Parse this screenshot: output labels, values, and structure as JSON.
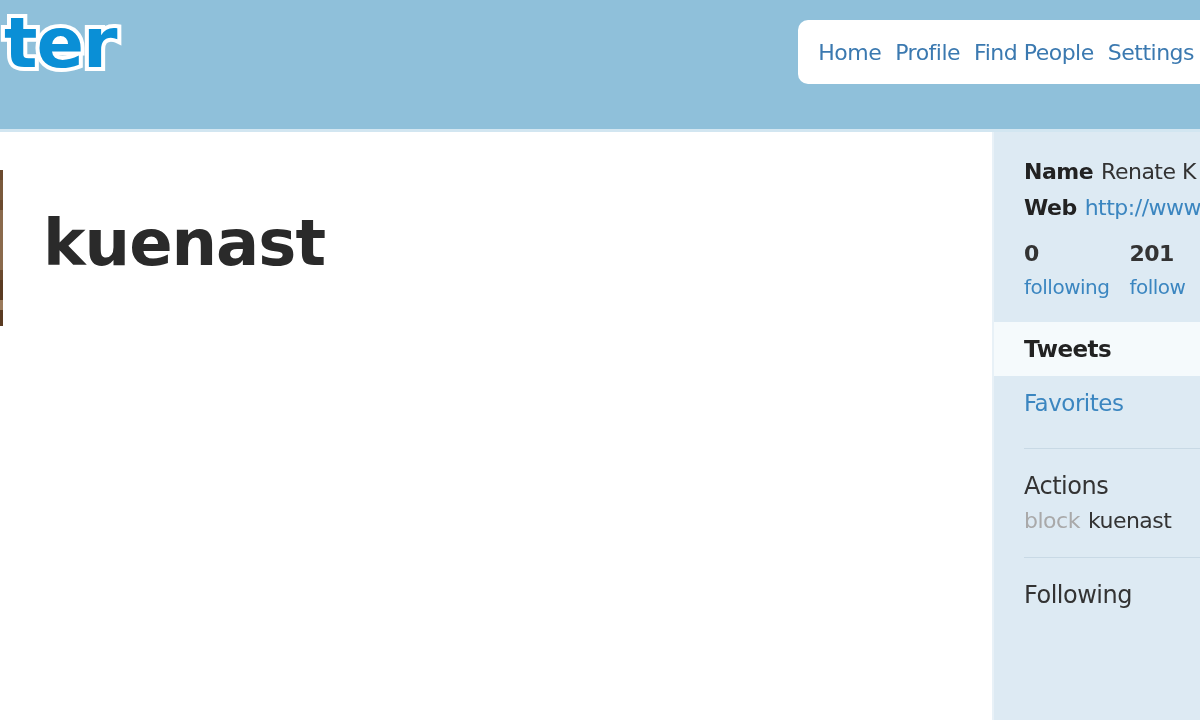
{
  "header": {
    "logo": "ter",
    "nav": [
      {
        "label": "Home"
      },
      {
        "label": "Profile"
      },
      {
        "label": "Find People"
      },
      {
        "label": "Settings"
      }
    ]
  },
  "profile": {
    "username": "kuenast"
  },
  "sidebar": {
    "name_label": "Name",
    "name_value": "Renate K",
    "web_label": "Web",
    "web_value": "http://www",
    "stats": [
      {
        "count": "0",
        "label": "following"
      },
      {
        "count": "201",
        "label": "follow"
      }
    ],
    "menu": [
      {
        "label": "Tweets",
        "selected": true
      },
      {
        "label": "Favorites",
        "selected": false
      }
    ],
    "actions": {
      "title": "Actions",
      "action": "block",
      "target": "kuenast"
    },
    "following": {
      "title": "Following"
    }
  }
}
